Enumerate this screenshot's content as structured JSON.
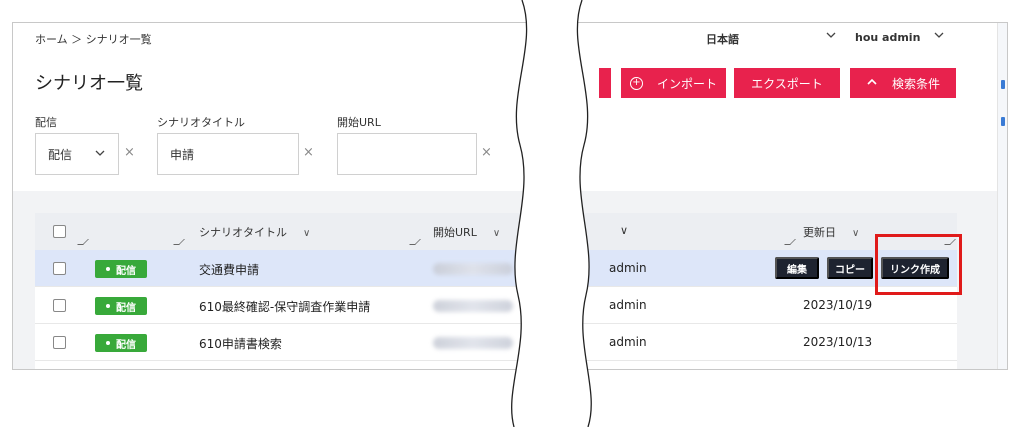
{
  "breadcrumb": "ホーム ＞ シナリオ一覧",
  "header": {
    "language": "日本語",
    "user": "hou admin"
  },
  "page_title": "シナリオ一覧",
  "toolbar": {
    "import_label": "インポート",
    "export_label": "エクスポート",
    "search_label": "検索条件"
  },
  "filters": {
    "status_label": "配信",
    "status_value": "配信",
    "title_label": "シナリオタイトル",
    "title_value": "申請",
    "url_label": "開始URL",
    "url_value": ""
  },
  "table": {
    "columns": {
      "title": "シナリオタイトル",
      "url": "開始URL",
      "updated": "更新日"
    },
    "rows": [
      {
        "status": "配信",
        "title": "交通費申請",
        "user": "admin",
        "date": ""
      },
      {
        "status": "配信",
        "title": "610最終確認-保守調査作業申請",
        "user": "admin",
        "date": "2023/10/19"
      },
      {
        "status": "配信",
        "title": "610申請書検索",
        "user": "admin",
        "date": "2023/10/13"
      }
    ],
    "row_actions": {
      "edit": "編集",
      "copy": "コピー",
      "link": "リンク作成"
    }
  },
  "colors": {
    "primary_red": "#e8224d",
    "badge_green": "#38a93a",
    "dark_button": "#1e2330",
    "selected_row": "#dde6f9",
    "highlight": "#e01a1a"
  }
}
